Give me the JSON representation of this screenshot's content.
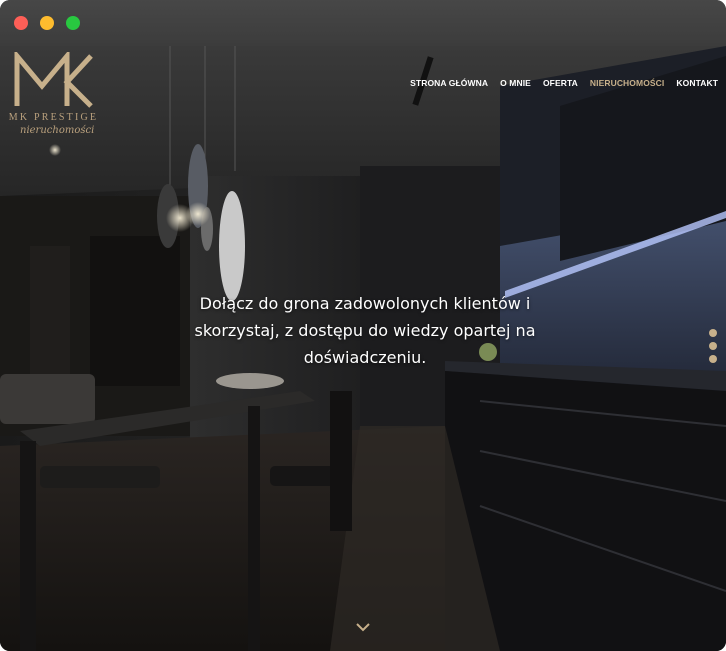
{
  "window": {
    "controls": [
      "close",
      "minimize",
      "zoom"
    ]
  },
  "logo": {
    "monogram": "MK",
    "brand": "MK PRESTIGE",
    "tagline": "nieruchomości"
  },
  "nav": {
    "items": [
      {
        "label": "STRONA GŁÓWNA",
        "active": false
      },
      {
        "label": "O MNIE",
        "active": false
      },
      {
        "label": "OFERTA",
        "active": false
      },
      {
        "label": "NIERUCHOMOŚCI",
        "active": true
      },
      {
        "label": "KONTAKT",
        "active": false
      }
    ]
  },
  "hero": {
    "headline_line1": "Dołącz do grona zadowolonych klientów i",
    "headline_line2": "skorzystaj, z dostępu do wiedzy opartej na",
    "headline_line3": "doświadczeniu.",
    "slide_count": 3,
    "scroll_icon": "chevron-down-icon"
  },
  "colors": {
    "accent_gold": "#c7b08b",
    "text_white": "#ffffff"
  }
}
